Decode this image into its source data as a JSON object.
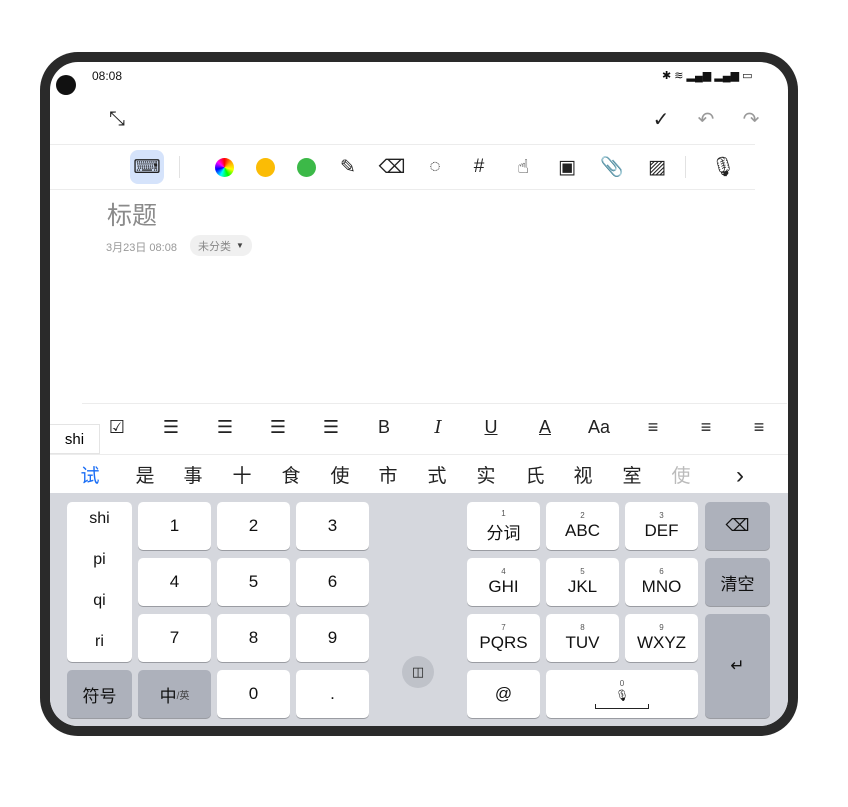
{
  "status": {
    "time": "08:08",
    "icons": [
      "bluetooth-icon",
      "wifi-icon",
      "signal-icon",
      "signal-icon",
      "battery-icon"
    ]
  },
  "topbar": {
    "left_icon": "collapse-icon",
    "right_icons": [
      "check-icon",
      "undo-icon",
      "redo-icon"
    ]
  },
  "toolbar": {
    "tools": [
      "keyboard-icon",
      "color-wheel-icon",
      "yellow-pen-icon",
      "green-pen-icon",
      "pencil-icon",
      "eraser-icon",
      "lasso-icon",
      "crop-icon",
      "finger-draw-off-icon",
      "image-icon",
      "attachment-icon",
      "texture-icon",
      "microphone-icon"
    ],
    "accent": "#d5e3fb",
    "colors": {
      "yellow": "#fbbc05",
      "green": "#3cb948"
    }
  },
  "note": {
    "title_placeholder": "标题",
    "date": "3月23日 08:08",
    "category": "未分类"
  },
  "format_bar": {
    "pinyin": "shi",
    "items": [
      {
        "icon": "checklist-icon",
        "glyph": "☑"
      },
      {
        "icon": "numbered-list-icon",
        "glyph": "☰"
      },
      {
        "icon": "lettered-list-icon",
        "glyph": "☰"
      },
      {
        "icon": "bullet-list-icon",
        "glyph": "☰"
      },
      {
        "icon": "bullet-list-bold-icon",
        "glyph": "☰"
      },
      {
        "icon": "bold-icon",
        "glyph": "B"
      },
      {
        "icon": "italic-icon",
        "glyph": "I"
      },
      {
        "icon": "underline-icon",
        "glyph": "U"
      },
      {
        "icon": "text-color-icon",
        "glyph": "A"
      },
      {
        "icon": "font-size-icon",
        "glyph": "Aa"
      },
      {
        "icon": "align-left-icon",
        "glyph": "≡"
      },
      {
        "icon": "align-center-icon",
        "glyph": "≡"
      },
      {
        "icon": "align-right-icon",
        "glyph": "≡"
      }
    ]
  },
  "candidates": [
    "试",
    "是",
    "事",
    "十",
    "食",
    "使",
    "市",
    "式",
    "实",
    "氏",
    "视",
    "室",
    "使"
  ],
  "candidate_more": "›",
  "keyboard": {
    "pinyin_list": [
      "shi",
      "pi",
      "qi",
      "ri"
    ],
    "num_keys": [
      "1",
      "2",
      "3",
      "4",
      "5",
      "6",
      "7",
      "8",
      "9"
    ],
    "symbols": "符号",
    "lang": "中",
    "lang_sub": "/英",
    "zero": "0",
    "dot": ".",
    "t9": [
      {
        "n": "1",
        "l": "分词"
      },
      {
        "n": "2",
        "l": "ABC"
      },
      {
        "n": "3",
        "l": "DEF"
      },
      {
        "n": "4",
        "l": "GHI"
      },
      {
        "n": "5",
        "l": "JKL"
      },
      {
        "n": "6",
        "l": "MNO"
      },
      {
        "n": "7",
        "l": "PQRS"
      },
      {
        "n": "8",
        "l": "TUV"
      },
      {
        "n": "9",
        "l": "WXYZ"
      }
    ],
    "at": "@",
    "space_num": "0",
    "clear": "清空",
    "backspace": "⌫",
    "enter": "↵",
    "split_icon": "split-keyboard-icon"
  }
}
